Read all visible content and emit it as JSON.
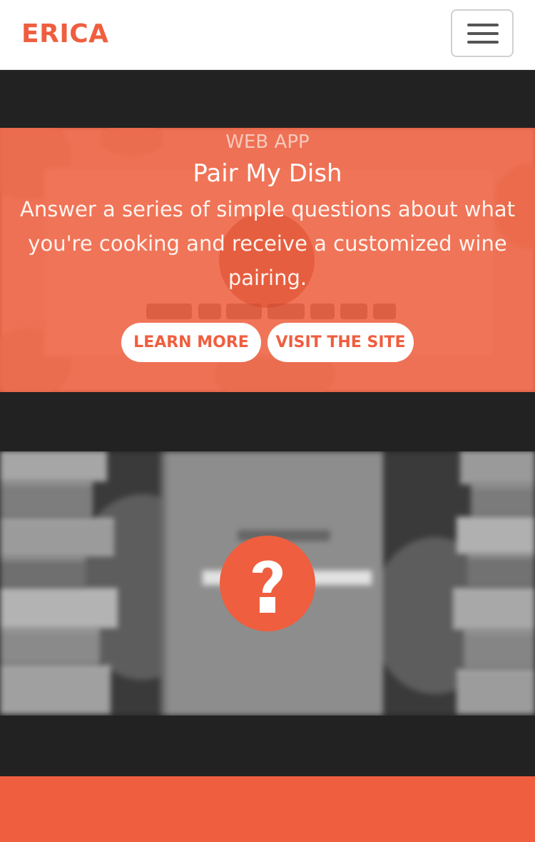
{
  "navbar": {
    "brand": "ERICA",
    "toggle_icon": "hamburger-icon"
  },
  "projects": [
    {
      "label": "WEB APP",
      "title": "Pair My Dish",
      "description": "Answer a series of simple questions about what you're cooking and receive a customized wine pairing.",
      "buttons": {
        "learn_more": "LEARN MORE",
        "visit_site": "VISIT THE SITE"
      }
    },
    {
      "thumbnail_icon": "question-mark-icon"
    }
  ],
  "colors": {
    "accent": "#ef5e3f",
    "dark": "#222222",
    "white": "#ffffff"
  }
}
